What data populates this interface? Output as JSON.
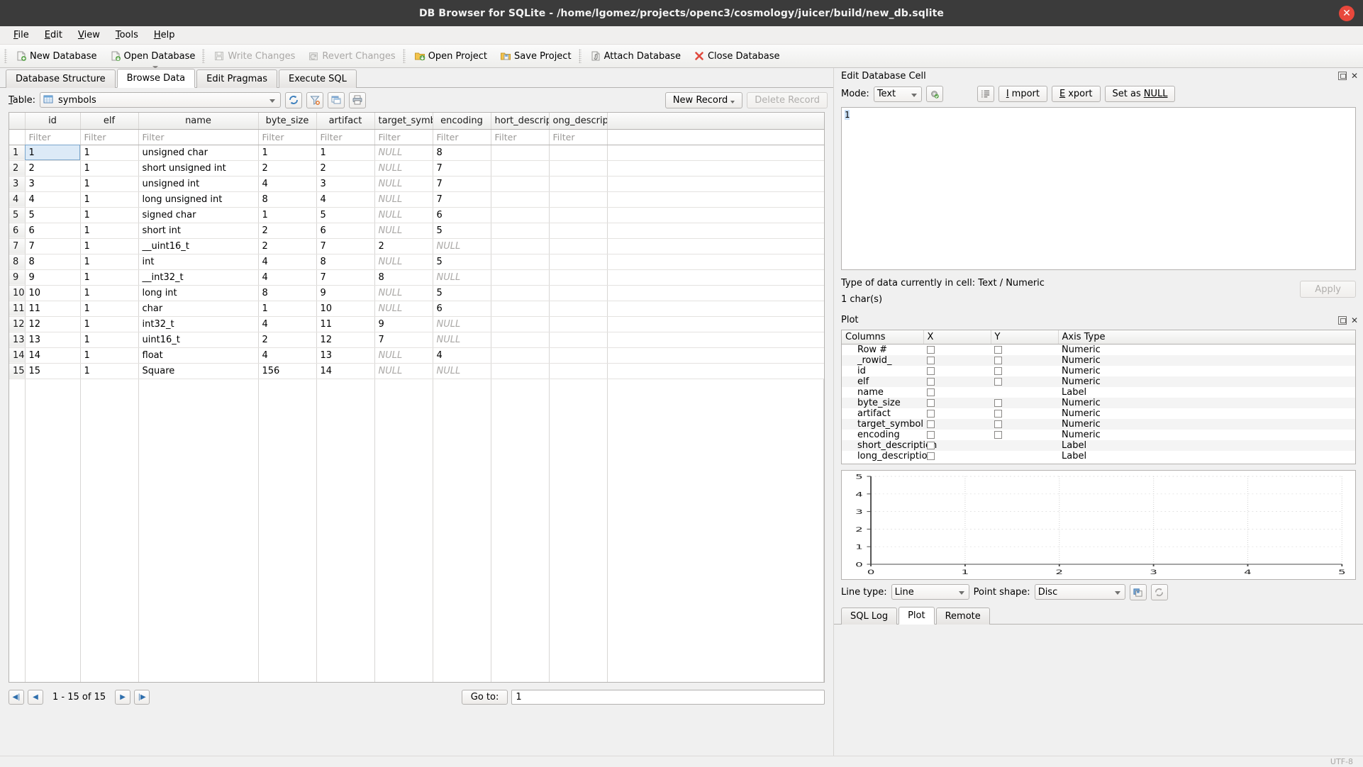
{
  "window": {
    "title": "DB Browser for SQLite - /home/lgomez/projects/openc3/cosmology/juicer/build/new_db.sqlite",
    "close_glyph": "✕"
  },
  "menubar": [
    {
      "label": "File",
      "mnemonic": "F"
    },
    {
      "label": "Edit",
      "mnemonic": "E"
    },
    {
      "label": "View",
      "mnemonic": "V"
    },
    {
      "label": "Tools",
      "mnemonic": "T"
    },
    {
      "label": "Help",
      "mnemonic": "H"
    }
  ],
  "toolbar": [
    {
      "label": "New Database",
      "icon": "new-database-icon",
      "enabled": true,
      "dropdown": false
    },
    {
      "label": "Open Database",
      "icon": "open-database-icon",
      "enabled": true,
      "dropdown": true
    },
    {
      "label": "Write Changes",
      "icon": "write-changes-icon",
      "enabled": false,
      "dropdown": false
    },
    {
      "label": "Revert Changes",
      "icon": "revert-changes-icon",
      "enabled": false,
      "dropdown": false
    },
    {
      "label": "Open Project",
      "icon": "open-project-icon",
      "enabled": true,
      "dropdown": false
    },
    {
      "label": "Save Project",
      "icon": "save-project-icon",
      "enabled": true,
      "dropdown": false
    },
    {
      "label": "Attach Database",
      "icon": "attach-database-icon",
      "enabled": true,
      "dropdown": false
    },
    {
      "label": "Close Database",
      "icon": "close-database-icon",
      "enabled": true,
      "dropdown": false
    }
  ],
  "tabs": [
    {
      "label": "Database Structure",
      "active": false
    },
    {
      "label": "Browse Data",
      "active": true
    },
    {
      "label": "Edit Pragmas",
      "active": false
    },
    {
      "label": "Execute SQL",
      "active": false
    }
  ],
  "browse": {
    "table_label": "Table:",
    "table_mnemonic": "T",
    "selected_table": "symbols",
    "table_icon": "table-icon",
    "tool_icons": [
      "refresh-icon",
      "clear-filters-icon",
      "save-results-view-icon",
      "print-icon"
    ],
    "new_record_label": "New Record",
    "delete_record_label": "Delete Record",
    "delete_record_enabled": false,
    "filter_placeholder": "Filter",
    "columns": [
      "id",
      "elf",
      "name",
      "byte_size",
      "artifact",
      "target_symbol",
      "encoding",
      "hort_descriptio",
      "ong_description"
    ],
    "rows": [
      {
        "n": "1",
        "cells": [
          "1",
          "1",
          "unsigned char",
          "1",
          "1",
          "NULL",
          "8",
          "",
          ""
        ]
      },
      {
        "n": "2",
        "cells": [
          "2",
          "1",
          "short unsigned int",
          "2",
          "2",
          "NULL",
          "7",
          "",
          ""
        ]
      },
      {
        "n": "3",
        "cells": [
          "3",
          "1",
          "unsigned int",
          "4",
          "3",
          "NULL",
          "7",
          "",
          ""
        ]
      },
      {
        "n": "4",
        "cells": [
          "4",
          "1",
          "long unsigned int",
          "8",
          "4",
          "NULL",
          "7",
          "",
          ""
        ]
      },
      {
        "n": "5",
        "cells": [
          "5",
          "1",
          "signed char",
          "1",
          "5",
          "NULL",
          "6",
          "",
          ""
        ]
      },
      {
        "n": "6",
        "cells": [
          "6",
          "1",
          "short int",
          "2",
          "6",
          "NULL",
          "5",
          "",
          ""
        ]
      },
      {
        "n": "7",
        "cells": [
          "7",
          "1",
          "__uint16_t",
          "2",
          "7",
          "2",
          "NULL",
          "",
          ""
        ]
      },
      {
        "n": "8",
        "cells": [
          "8",
          "1",
          "int",
          "4",
          "8",
          "NULL",
          "5",
          "",
          ""
        ]
      },
      {
        "n": "9",
        "cells": [
          "9",
          "1",
          "__int32_t",
          "4",
          "7",
          "8",
          "NULL",
          "",
          ""
        ]
      },
      {
        "n": "10",
        "cells": [
          "10",
          "1",
          "long int",
          "8",
          "9",
          "NULL",
          "5",
          "",
          ""
        ]
      },
      {
        "n": "11",
        "cells": [
          "11",
          "1",
          "char",
          "1",
          "10",
          "NULL",
          "6",
          "",
          ""
        ]
      },
      {
        "n": "12",
        "cells": [
          "12",
          "1",
          "int32_t",
          "4",
          "11",
          "9",
          "NULL",
          "",
          ""
        ]
      },
      {
        "n": "13",
        "cells": [
          "13",
          "1",
          "uint16_t",
          "2",
          "12",
          "7",
          "NULL",
          "",
          ""
        ]
      },
      {
        "n": "14",
        "cells": [
          "14",
          "1",
          "float",
          "4",
          "13",
          "NULL",
          "4",
          "",
          ""
        ]
      },
      {
        "n": "15",
        "cells": [
          "15",
          "1",
          "Square",
          "156",
          "14",
          "NULL",
          "NULL",
          "",
          ""
        ]
      }
    ],
    "selected_cell": {
      "row": 0,
      "col": 0
    },
    "nav": {
      "first_glyph": "◀|",
      "prev_glyph": "◀",
      "next_glyph": "▶",
      "last_glyph": "|▶",
      "range_text": "1 - 15 of 15",
      "goto_label": "Go to:",
      "goto_value": "1"
    }
  },
  "edit_cell": {
    "panel_title": "Edit Database Cell",
    "mode_label": "Mode:",
    "mode_value": "Text",
    "apply_settings_icon": "apply-settings-icon",
    "word_wrap_icon": "word-wrap-icon",
    "import_label": "Import",
    "import_mnemonic": "I",
    "export_label": "Export",
    "export_mnemonic": "E",
    "set_null_label": "Set as NULL",
    "set_null_mnemonic": "NULL",
    "content": "1",
    "type_text": "Type of data currently in cell: Text / Numeric",
    "size_text": "1 char(s)",
    "apply_label": "Apply",
    "apply_enabled": false
  },
  "plot": {
    "panel_title": "Plot",
    "headers": [
      "Columns",
      "X",
      "Y",
      "Axis Type"
    ],
    "rows": [
      {
        "name": "Row #",
        "x": true,
        "y": true,
        "axis": "Numeric"
      },
      {
        "name": "_rowid_",
        "x": true,
        "y": true,
        "axis": "Numeric"
      },
      {
        "name": "id",
        "x": true,
        "y": true,
        "axis": "Numeric"
      },
      {
        "name": "elf",
        "x": true,
        "y": true,
        "axis": "Numeric"
      },
      {
        "name": "name",
        "x": true,
        "y": false,
        "axis": "Label"
      },
      {
        "name": "byte_size",
        "x": true,
        "y": true,
        "axis": "Numeric"
      },
      {
        "name": "artifact",
        "x": true,
        "y": true,
        "axis": "Numeric"
      },
      {
        "name": "target_symbol",
        "x": true,
        "y": true,
        "axis": "Numeric"
      },
      {
        "name": "encoding",
        "x": true,
        "y": true,
        "axis": "Numeric"
      },
      {
        "name": "short_description",
        "x": true,
        "y": false,
        "axis": "Label"
      },
      {
        "name": "long_description",
        "x": true,
        "y": false,
        "axis": "Label"
      }
    ],
    "line_type_label": "Line type:",
    "line_type_value": "Line",
    "point_shape_label": "Point shape:",
    "point_shape_value": "Disc",
    "save_plot_icon": "save-plot-icon",
    "reload_plot_icon": "reload-plot-icon"
  },
  "chart_data": {
    "type": "scatter",
    "title": "",
    "xlabel": "",
    "ylabel": "",
    "series": [],
    "x_ticks": [
      "0",
      "1",
      "2",
      "3",
      "4",
      "5"
    ],
    "y_ticks": [
      "0",
      "1",
      "2",
      "3",
      "4",
      "5"
    ],
    "xlim": [
      0,
      5
    ],
    "ylim": [
      0,
      5
    ],
    "grid": true,
    "legend": "none"
  },
  "bottom_tabs": [
    {
      "label": "SQL Log",
      "active": false
    },
    {
      "label": "Plot",
      "active": true
    },
    {
      "label": "Remote",
      "active": false
    }
  ],
  "statusbar": {
    "encoding": "UTF-8"
  },
  "colors": {
    "titlebar_bg": "#3b3b3b",
    "close_red": "#e8483c",
    "selection_blue": "#dceaf7",
    "accent_blue": "#2f6fad"
  }
}
